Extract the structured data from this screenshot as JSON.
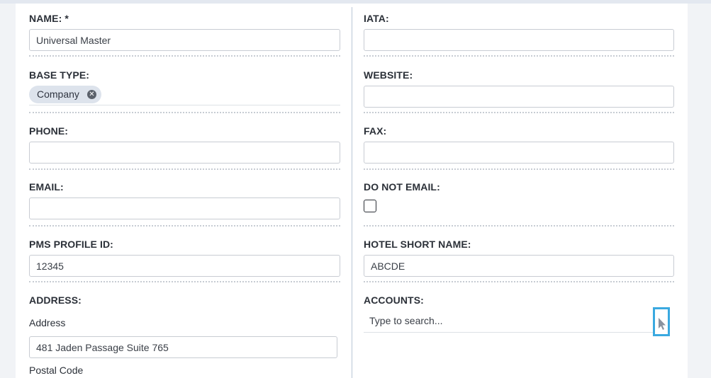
{
  "left": {
    "name_label": "NAME: *",
    "name_value": "Universal Master",
    "base_type_label": "BASE TYPE:",
    "base_type_chip": "Company",
    "phone_label": "PHONE:",
    "phone_value": "",
    "email_label": "EMAIL:",
    "email_value": "",
    "pms_label": "PMS PROFILE ID:",
    "pms_value": "12345",
    "address_label": "ADDRESS:",
    "address_sublabel": "Address",
    "address_value": "481 Jaden Passage Suite 765",
    "postal_label": "Postal Code"
  },
  "right": {
    "iata_label": "IATA:",
    "iata_value": "",
    "website_label": "WEBSITE:",
    "website_value": "",
    "fax_label": "FAX:",
    "fax_value": "",
    "do_not_email_label": "DO NOT EMAIL:",
    "do_not_email_checked": false,
    "hotel_short_label": "HOTEL SHORT NAME:",
    "hotel_short_value": "ABCDE",
    "accounts_label": "ACCOUNTS:",
    "accounts_placeholder": "Type to search..."
  },
  "icons": {
    "chip_remove": "close-circle-icon",
    "cursor": "mouse-pointer-icon"
  },
  "colors": {
    "highlight": "#3aa9e0",
    "chip_bg": "#dde3ec"
  }
}
